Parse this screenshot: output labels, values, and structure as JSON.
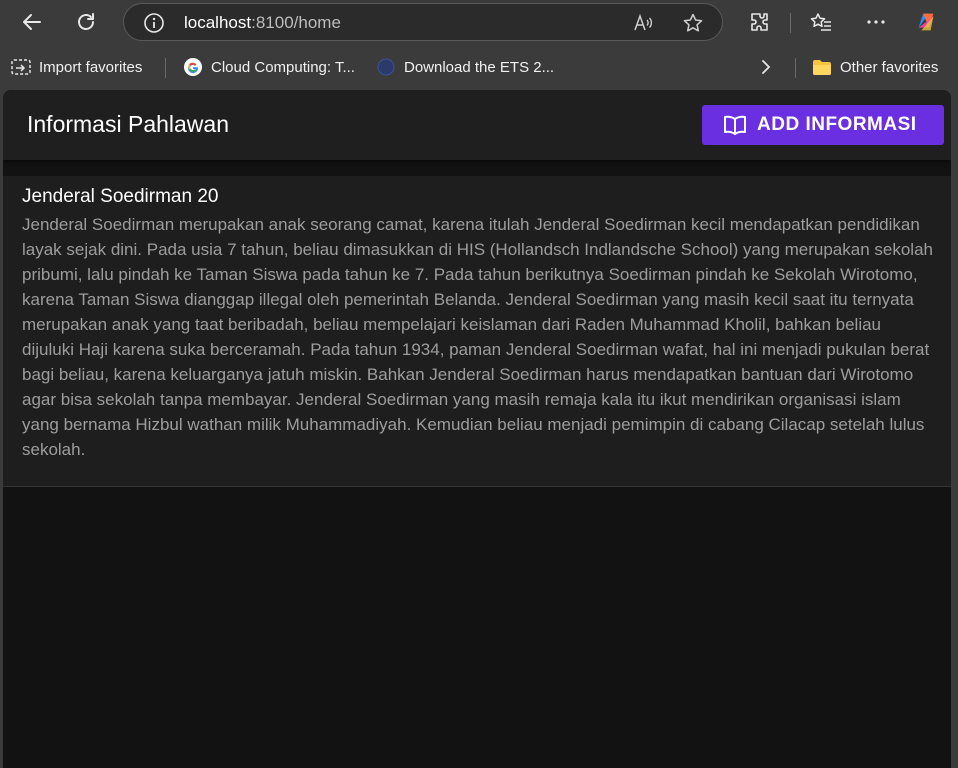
{
  "browser": {
    "url_host": "localhost",
    "url_path": ":8100/home",
    "favorites": [
      {
        "label": "Import favorites",
        "icon": "import-favorites-icon"
      },
      {
        "label": "Cloud Computing: T...",
        "icon": "google-icon"
      },
      {
        "label": "Download the ETS 2...",
        "icon": "globe-icon"
      }
    ],
    "other_favorites": "Other favorites"
  },
  "app": {
    "title": "Informasi Pahlawan",
    "add_button_label": "ADD INFORMASI",
    "accent_color": "#6a2fe0"
  },
  "card": {
    "title": "Jenderal Soedirman 20",
    "body": "Jenderal Soedirman merupakan anak seorang camat, karena itulah Jenderal Soedirman kecil mendapatkan pendidikan layak sejak dini. Pada usia 7 tahun, beliau dimasukkan di HIS (Hollandsch Indlandsche School) yang merupakan sekolah pribumi, lalu pindah ke Taman Siswa pada tahun ke 7. Pada tahun berikutnya Soedirman pindah ke Sekolah Wirotomo, karena Taman Siswa dianggap illegal oleh pemerintah Belanda. Jenderal Soedirman yang masih kecil saat itu ternyata merupakan anak yang taat beribadah, beliau mempelajari keislaman dari Raden Muhammad Kholil, bahkan beliau dijuluki Haji karena suka berceramah. Pada tahun 1934, paman Jenderal Soedirman wafat, hal ini menjadi pukulan berat bagi beliau, karena keluarganya jatuh miskin. Bahkan Jenderal Soedirman harus mendapatkan bantuan dari Wirotomo agar bisa sekolah tanpa membayar. Jenderal Soedirman yang masih remaja kala itu ikut mendirikan organisasi islam yang bernama Hizbul wathan milik Muhammadiyah. Kemudian beliau menjadi pemimpin di cabang Cilacap setelah lulus sekolah."
  }
}
